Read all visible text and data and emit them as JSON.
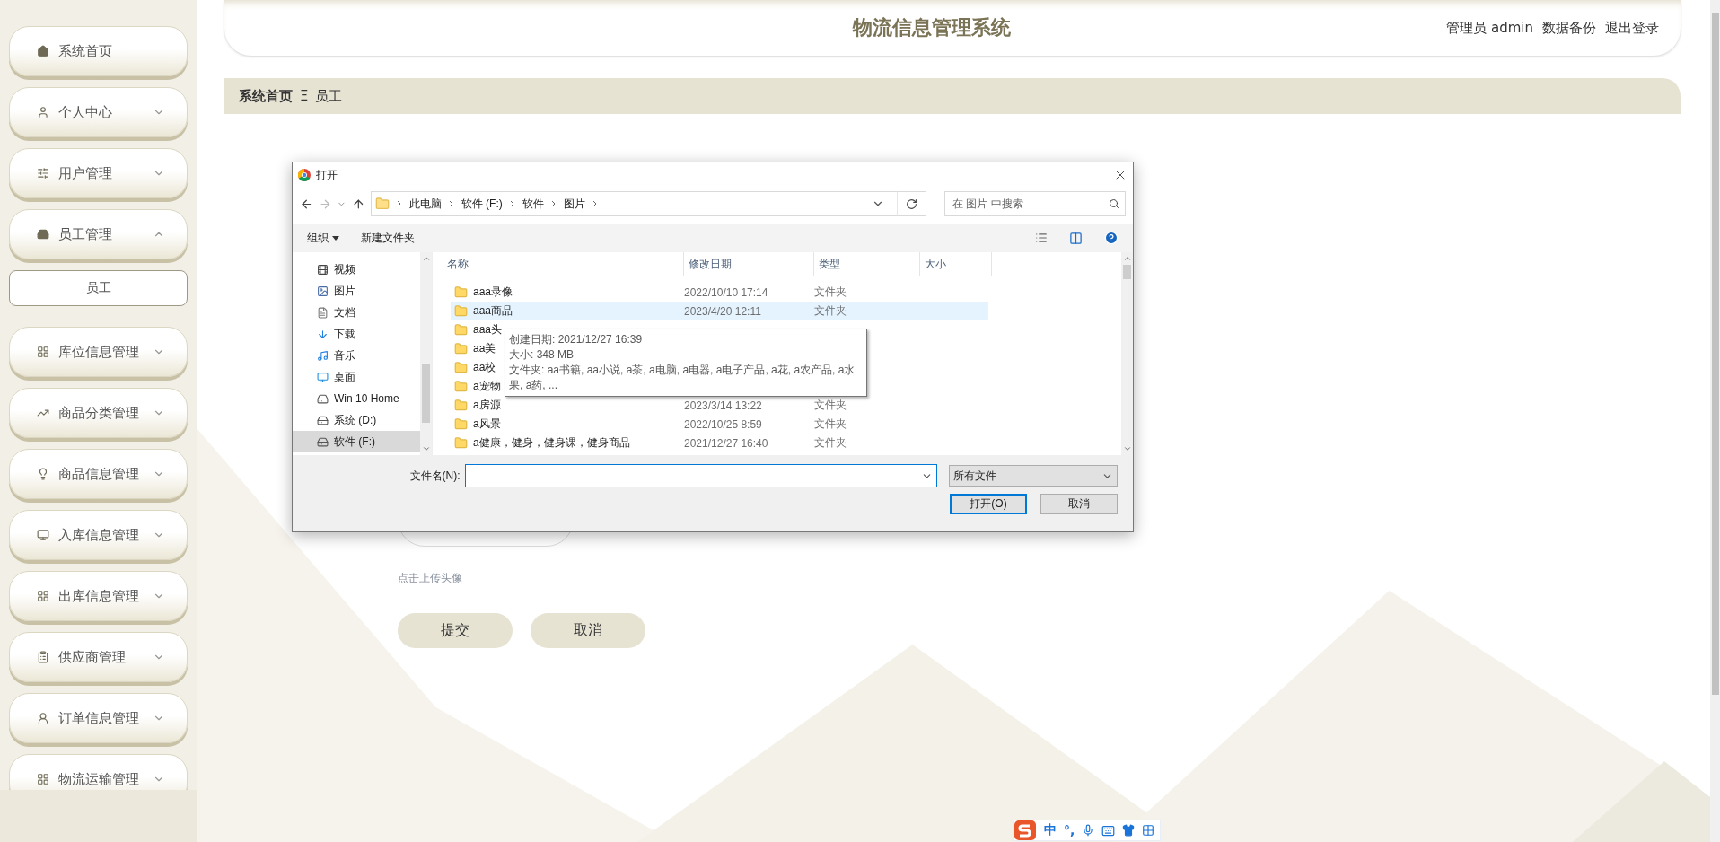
{
  "sidebar": {
    "items": [
      {
        "label": "系统首页",
        "kind": "link"
      },
      {
        "label": "个人中心",
        "kind": "menu",
        "expanded": false
      },
      {
        "label": "用户管理",
        "kind": "menu",
        "expanded": false
      },
      {
        "label": "员工管理",
        "kind": "menu",
        "expanded": true,
        "children": [
          {
            "label": "员工"
          }
        ]
      },
      {
        "label": "库位信息管理",
        "kind": "menu",
        "expanded": false
      },
      {
        "label": "商品分类管理",
        "kind": "menu",
        "expanded": false
      },
      {
        "label": "商品信息管理",
        "kind": "menu",
        "expanded": false
      },
      {
        "label": "入库信息管理",
        "kind": "menu",
        "expanded": false
      },
      {
        "label": "出库信息管理",
        "kind": "menu",
        "expanded": false
      },
      {
        "label": "供应商管理",
        "kind": "menu",
        "expanded": false
      },
      {
        "label": "订单信息管理",
        "kind": "menu",
        "expanded": false
      },
      {
        "label": "物流运输管理",
        "kind": "menu",
        "expanded": false
      }
    ]
  },
  "header": {
    "title": "物流信息管理系统",
    "links": [
      "管理员 admin",
      "数据备份",
      "退出登录"
    ]
  },
  "breadcrumb": {
    "items": [
      "系统首页",
      "员工"
    ],
    "separator": "Ξ"
  },
  "form": {
    "upload_hint": "点击上传头像",
    "buttons": [
      "提交",
      "取消"
    ]
  },
  "dialog": {
    "title": "打开",
    "path": [
      "此电脑",
      "软件 (F:)",
      "软件",
      "图片"
    ],
    "search": {
      "placeholder": "在 图片 中搜索"
    },
    "toolbar": [
      "组织",
      "新建文件夹"
    ],
    "nav": [
      {
        "label": "视频",
        "selected": false
      },
      {
        "label": "图片",
        "selected": false
      },
      {
        "label": "文档",
        "selected": false
      },
      {
        "label": "下载",
        "selected": false
      },
      {
        "label": "音乐",
        "selected": false
      },
      {
        "label": "桌面",
        "selected": false
      },
      {
        "label": "Win 10 Home",
        "selected": false
      },
      {
        "label": "系统 (D:)",
        "selected": false
      },
      {
        "label": "软件 (F:)",
        "selected": true
      }
    ],
    "columns": [
      "名称",
      "修改日期",
      "类型",
      "大小"
    ],
    "rows": [
      {
        "name": "aaa录像",
        "date": "2022/10/10 17:14",
        "type": "文件夹",
        "selected": false
      },
      {
        "name": "aaa商品",
        "date": "2023/4/20 12:11",
        "type": "文件夹",
        "selected": true
      },
      {
        "name": "aaa头",
        "selected": false
      },
      {
        "name": "aa美",
        "selected": false
      },
      {
        "name": "aa校",
        "selected": false
      },
      {
        "name": "a宠物",
        "selected": false
      },
      {
        "name": "a房源",
        "date": "2023/3/14 13:22",
        "type": "文件夹",
        "selected": false
      },
      {
        "name": "a风景",
        "date": "2022/10/25 8:59",
        "type": "文件夹",
        "selected": false
      },
      {
        "name": "a健康，健身，健身课，健身商品",
        "date": "2021/12/27 16:40",
        "type": "文件夹",
        "selected": false
      }
    ],
    "tooltip": [
      "创建日期: 2021/12/27 16:39",
      "大小: 348 MB",
      "文件夹: aa书籍, aa小说, a茶, a电脑, a电器, a电子产品, a花, a农产品, a水果, a药, ..."
    ],
    "filename_label": "文件名(N):",
    "file_type": "所有文件",
    "buttons": [
      "打开(O)",
      "取消"
    ]
  },
  "ime": {
    "chars": [
      "中",
      "°,"
    ]
  }
}
